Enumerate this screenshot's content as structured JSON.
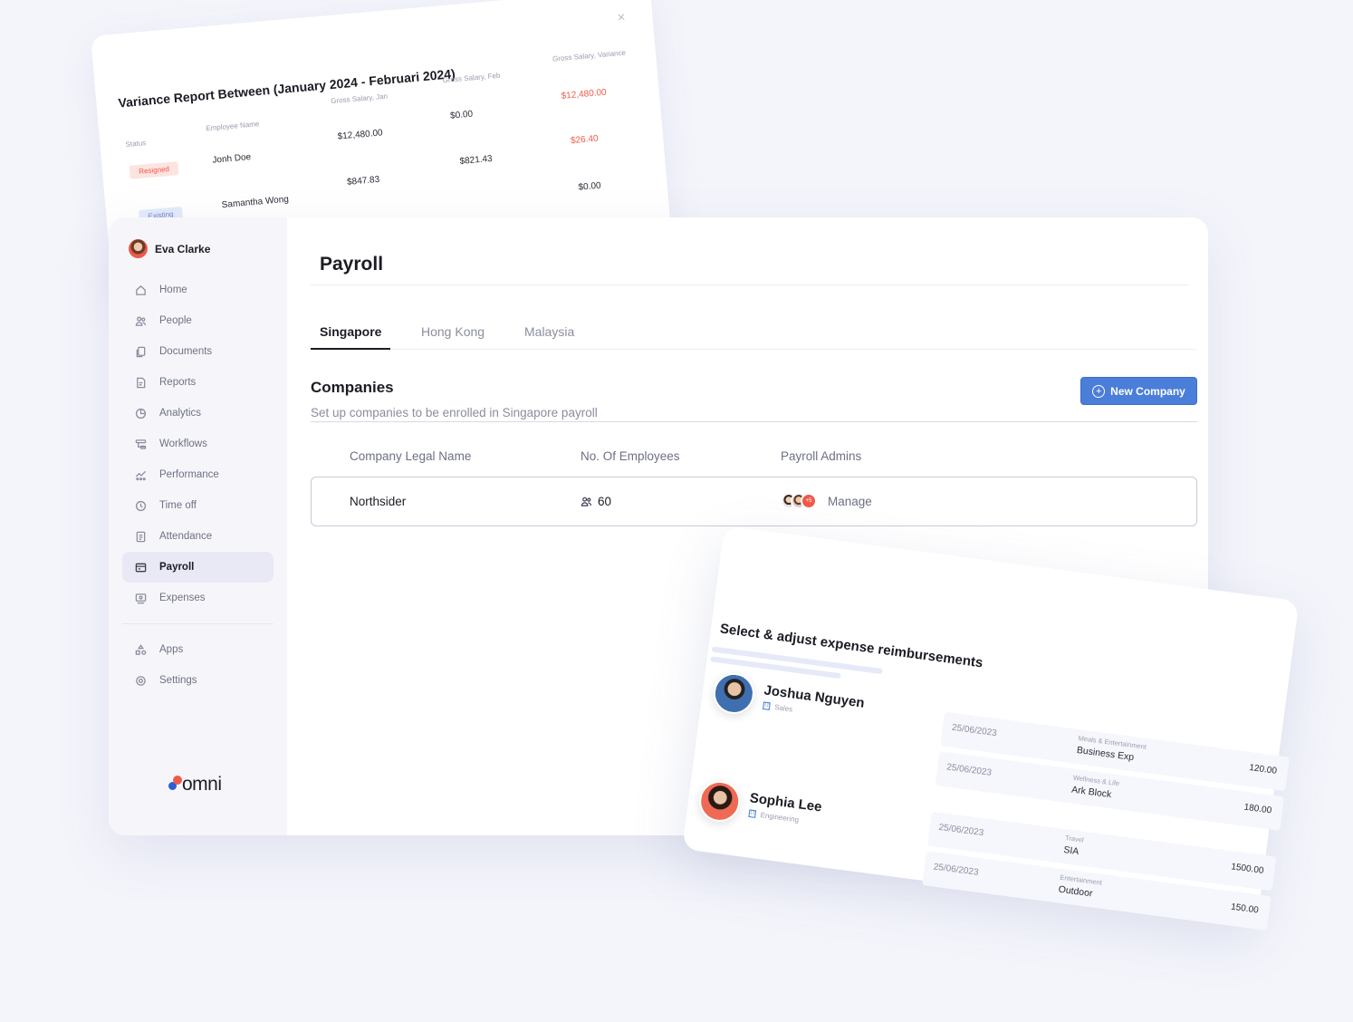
{
  "variance_report": {
    "title": "Variance Report Between (January 2024 - Februari 2024)",
    "close_glyph": "×",
    "columns": {
      "status": "Status",
      "employee": "Employee Name",
      "gross_jan": "Gross Salary, Jan",
      "gross_feb": "Gross Salary, Feb",
      "gross_variance": "Gross Salary, Variance"
    },
    "rows": [
      {
        "status": "Resigned",
        "name": "Jonh Doe",
        "jan": "$12,480.00",
        "feb": "$0.00",
        "variance": "$12,480.00"
      },
      {
        "status": "Existing",
        "name": "Samantha Wong",
        "jan": "$847.83",
        "feb": "$821.43",
        "variance": "$26.40"
      }
    ],
    "extra_variance": "$0.00"
  },
  "sidebar": {
    "user_name": "Eva Clarke",
    "items": [
      {
        "label": "Home",
        "icon": "home-icon"
      },
      {
        "label": "People",
        "icon": "people-icon"
      },
      {
        "label": "Documents",
        "icon": "documents-icon"
      },
      {
        "label": "Reports",
        "icon": "reports-icon"
      },
      {
        "label": "Analytics",
        "icon": "analytics-icon"
      },
      {
        "label": "Workflows",
        "icon": "workflows-icon"
      },
      {
        "label": "Performance",
        "icon": "performance-icon"
      },
      {
        "label": "Time off",
        "icon": "clock-icon"
      },
      {
        "label": "Attendance",
        "icon": "attendance-icon"
      },
      {
        "label": "Payroll",
        "icon": "payroll-icon",
        "active": true
      },
      {
        "label": "Expenses",
        "icon": "expenses-icon"
      }
    ],
    "bottom_items": [
      {
        "label": "Apps",
        "icon": "apps-icon"
      },
      {
        "label": "Settings",
        "icon": "gear-icon"
      }
    ],
    "logo_text": "omni"
  },
  "page": {
    "title": "Payroll",
    "tabs": [
      {
        "label": "Singapore",
        "active": true
      },
      {
        "label": "Hong Kong"
      },
      {
        "label": "Malaysia"
      }
    ],
    "section_title": "Companies",
    "section_subtitle": "Set up companies to be enrolled in Singapore payroll",
    "new_button": "New Company",
    "table": {
      "headers": [
        "Company Legal Name",
        "No. Of Employees",
        "Payroll Admins"
      ],
      "rows": [
        {
          "name": "Northsider",
          "employees": "60",
          "admin_extra": "+5",
          "action": "Manage"
        }
      ]
    }
  },
  "expenses": {
    "title": "Select & adjust expense reimbursements",
    "people": [
      {
        "name": "Joshua Nguyen",
        "dept": "Sales"
      },
      {
        "name": "Sophia Lee",
        "dept": "Engineering"
      }
    ],
    "rows": [
      {
        "date": "25/06/2023",
        "category": "Meals & Entertainment",
        "item": "Business Exp",
        "amount": "120.00"
      },
      {
        "date": "25/06/2023",
        "category": "Wellness & Life",
        "item": "Ark Block",
        "amount": "180.00"
      },
      {
        "date": "25/06/2023",
        "category": "Travel",
        "item": "SIA",
        "amount": "1500.00"
      },
      {
        "date": "25/06/2023",
        "category": "Entertainment",
        "item": "Outdoor",
        "amount": "150.00"
      }
    ]
  },
  "colors": {
    "accent_blue": "#4b7ed8",
    "accent_red": "#ef5a4a",
    "background": "#f4f5fb"
  }
}
